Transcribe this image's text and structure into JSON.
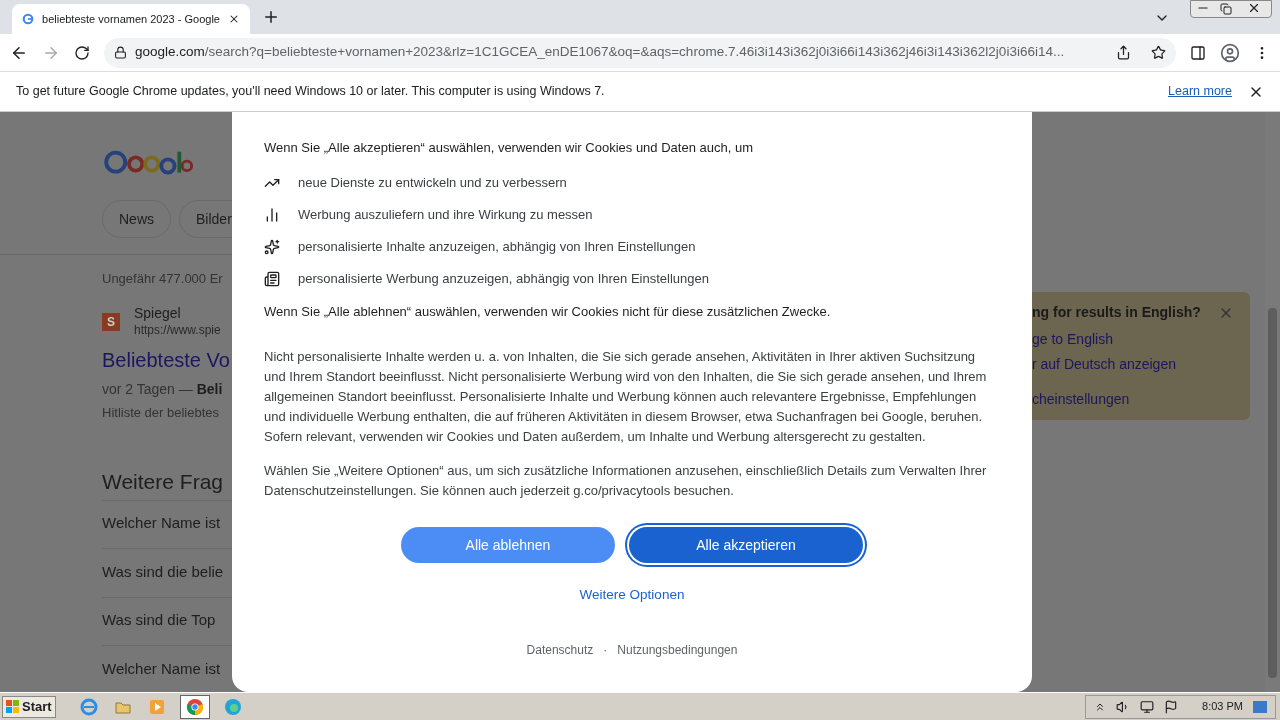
{
  "browser": {
    "tab": {
      "title": "beliebteste vornamen 2023 - Google",
      "selected": true
    },
    "url_host": "google.com",
    "url_rest": "/search?q=beliebteste+vornamen+2023&rlz=1C1GCEA_enDE1067&oq=&aqs=chrome.7.46i3i143i362j0i3i66i143i362j46i3i143i362l2j0i3i66i14...",
    "infobar": {
      "message": "To get future Google Chrome updates, you'll need Windows 10 or later. This computer is using Windows 7.",
      "link": "Learn more"
    }
  },
  "results": {
    "chips": [
      {
        "label": "News",
        "selected": false
      },
      {
        "label": "Bilder",
        "selected": false
      }
    ],
    "count": "Ungefähr 477.000 Er",
    "result": {
      "site_icon": "S",
      "site": "Spiegel",
      "url": "https://www.spie",
      "title": "Beliebteste Vo",
      "date": "vor 2 Tagen — ",
      "bold": "Beli",
      "snippet": "Hitliste der beliebtes"
    },
    "questions_title": "Weitere Frag",
    "questions": [
      "Welcher Name ist",
      "Was sind die belie",
      "Was sind die Top",
      "Welcher Name ist"
    ]
  },
  "language_card": {
    "title": "ng for results in English?",
    "links": [
      "ge to English",
      "r auf Deutsch anzeigen",
      "cheinstellungen"
    ]
  },
  "consent": {
    "intro": "Wenn Sie „Alle akzeptieren“ auswählen, verwenden wir Cookies und Daten auch, um",
    "purposes": [
      {
        "kind": "trend",
        "text": "neue Dienste zu entwickeln und zu verbessern"
      },
      {
        "kind": "bars",
        "text": "Werbung auszuliefern und ihre Wirkung zu messen"
      },
      {
        "kind": "sparkle",
        "text": "personalisierte Inhalte anzuzeigen, abhängig von Ihren Einstellungen"
      },
      {
        "kind": "ad",
        "text": "personalisierte Werbung anzuzeigen, abhängig von Ihren Einstellungen"
      }
    ],
    "reject_note": "Wenn Sie „Alle ablehnen“ auswählen, verwenden wir Cookies nicht für diese zusätzlichen Zwecke.",
    "paragraphs": [
      "Nicht personalisierte Inhalte werden u. a. von Inhalten, die Sie sich gerade ansehen, Aktivitäten in Ihrer aktiven Suchsitzung und Ihrem Standort beeinflusst. Nicht personalisierte Werbung wird von den Inhalten, die Sie sich gerade ansehen, und Ihrem allgemeinen Standort beeinflusst. Personalisierte Inhalte und Werbung können auch relevantere Ergebnisse, Empfehlungen und individuelle Werbung enthalten, die auf früheren Aktivitäten in diesem Browser, etwa Suchanfragen bei Google, beruhen. Sofern relevant, verwenden wir Cookies und Daten außerdem, um Inhalte und Werbung altersgerecht zu gestalten.",
      "Wählen Sie „Weitere Optionen“ aus, um sich zusätzliche Informationen anzusehen, einschließlich Details zum Verwalten Ihrer Datenschutzeinstellungen. Sie können auch jederzeit g.co/privacytools besuchen."
    ],
    "buttons": [
      {
        "label": "Alle ablehnen",
        "focused": false
      },
      {
        "label": "Alle akzeptieren",
        "focused": true
      }
    ],
    "more": "Weitere Optionen",
    "footer": [
      "Datenschutz",
      "·",
      "Nutzungsbedingungen"
    ]
  },
  "taskbar": {
    "start": "Start",
    "apps": [
      {
        "kind": "ie",
        "selected": false
      },
      {
        "kind": "folder",
        "selected": false
      },
      {
        "kind": "media",
        "selected": false
      },
      {
        "kind": "chrome",
        "selected": true
      },
      {
        "kind": "edge",
        "selected": false
      }
    ],
    "clock": "8:03 PM"
  }
}
